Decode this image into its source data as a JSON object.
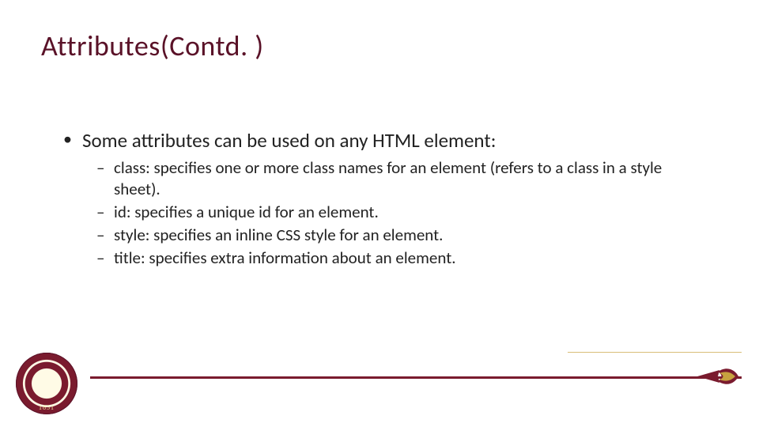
{
  "title": "Attributes(Contd. )",
  "lead": "Some attributes can be used on any HTML element:",
  "items": [
    "class: specifies one or more class names for an element (refers to a class in a style sheet).",
    "id: specifies a unique id for an element.",
    "style: specifies an inline CSS style for an element.",
    "title: specifies extra information about an element."
  ],
  "seal_year": "1851",
  "colors": {
    "brand": "#7a1b2e",
    "gold": "#c7a23f"
  }
}
